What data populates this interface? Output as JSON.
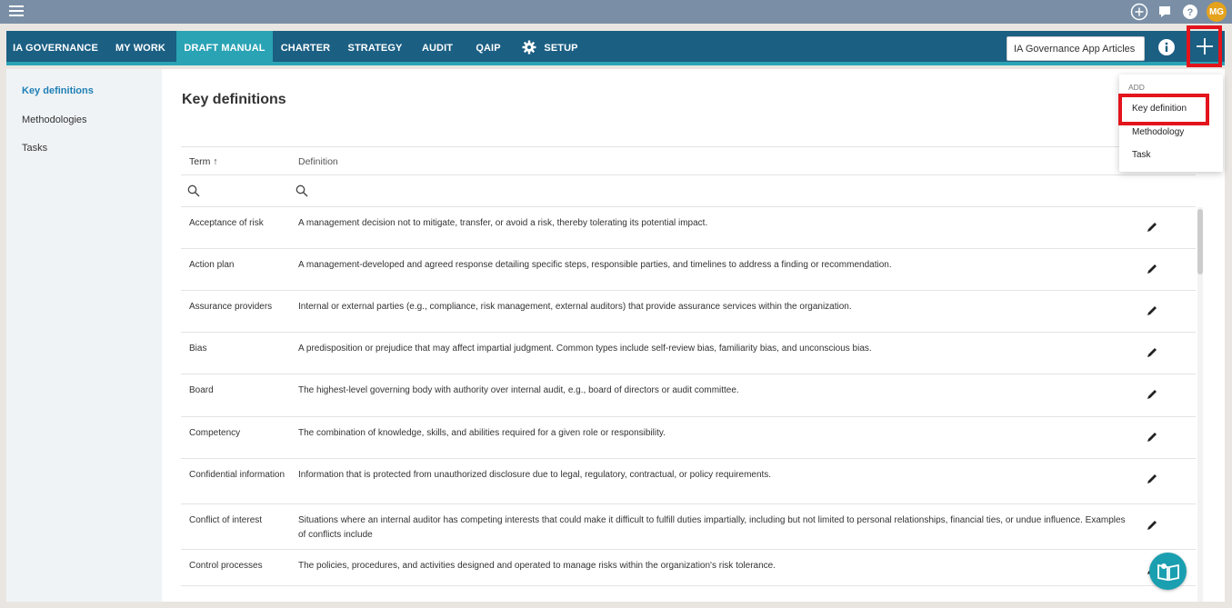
{
  "topbar": {
    "menu_icon": "hamburger-icon",
    "icons": [
      "plus-circle-icon",
      "chat-icon",
      "help-icon"
    ],
    "avatar_initials": "MG",
    "avatar_color": "#e5a21d"
  },
  "nav": {
    "tabs": [
      {
        "label": "IA GOVERNANCE"
      },
      {
        "label": "MY WORK"
      },
      {
        "label": "DRAFT MANUAL",
        "active": true
      },
      {
        "label": "CHARTER"
      },
      {
        "label": "STRATEGY"
      },
      {
        "label": "AUDIT"
      },
      {
        "label": "QAIP"
      },
      {
        "label": "SETUP",
        "icon": "gear-icon"
      }
    ],
    "search_value": "IA Governance App Articles",
    "accent_color": "#1b5f83",
    "active_color": "#2aa3b5"
  },
  "sidebar": {
    "items": [
      {
        "label": "Key definitions",
        "active": true
      },
      {
        "label": "Methodologies"
      },
      {
        "label": "Tasks"
      }
    ]
  },
  "main": {
    "title": "Key definitions",
    "table": {
      "columns": {
        "term": "Term ↑",
        "definition": "Definition"
      },
      "rows": [
        {
          "term": "Acceptance of risk",
          "definition": "A management decision not to mitigate, transfer, or avoid a risk, thereby tolerating its potential impact."
        },
        {
          "term": "Action plan",
          "definition": "A management-developed and agreed response detailing specific steps, responsible parties, and timelines to address a finding or recommendation."
        },
        {
          "term": "Assurance providers",
          "definition": "Internal or external parties (e.g., compliance, risk management, external auditors) that provide assurance services within the organization."
        },
        {
          "term": "Bias",
          "definition": "A predisposition or prejudice that may affect impartial judgment. Common types include self-review bias, familiarity bias, and unconscious bias."
        },
        {
          "term": "Board",
          "definition": "The highest-level governing body with authority over internal audit, e.g., board of directors or audit committee."
        },
        {
          "term": "Competency",
          "definition": "The combination of knowledge, skills, and abilities required for a given role or responsibility."
        },
        {
          "term": "Confidential information",
          "definition": "Information that is protected from unauthorized disclosure due to legal, regulatory, contractual, or policy requirements."
        },
        {
          "term": "Conflict of interest",
          "definition": "Situations where an internal auditor has competing interests that could make it difficult to fulfill duties impartially, including but not limited to personal relationships, financial ties, or undue influence. Examples of conflicts include"
        },
        {
          "term": "Control processes",
          "definition": "The policies, procedures, and activities designed and operated to manage risks within the organization's risk tolerance."
        }
      ]
    }
  },
  "add_menu": {
    "header": "ADD",
    "items": [
      "Key definition",
      "Methodology",
      "Task"
    ]
  },
  "highlight_color": "#e3141c"
}
